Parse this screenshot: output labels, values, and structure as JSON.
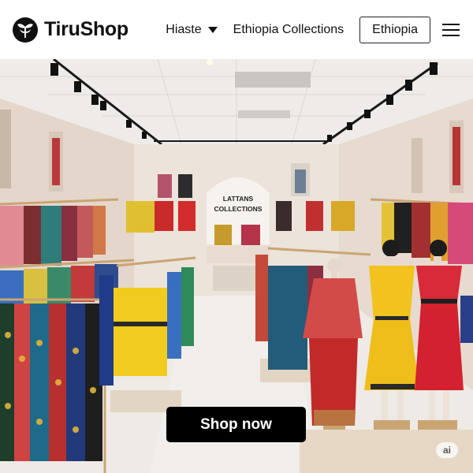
{
  "header": {
    "brand_name": "TiruShop",
    "logo_icon": "tirushop-logo-icon",
    "nav_items": [
      {
        "label": "Hiaste",
        "has_dropdown": true
      },
      {
        "label": "Ethiopia Collections",
        "has_dropdown": false
      }
    ],
    "country_button": "Ethiopia",
    "menu_icon": "hamburger-menu-icon"
  },
  "hero": {
    "image_description_icon": "store-interior-photo",
    "sign_line1": "LATTANS",
    "sign_line2": "COLLECTIONS",
    "cta_label": "Shop now",
    "ai_badge": "ai"
  },
  "colors": {
    "header_bg": "#ffffff",
    "cta_bg": "#000000",
    "cta_text": "#ffffff",
    "wall": "#e9e0d8",
    "floor": "#eeeae6",
    "rail": "#c9a574"
  }
}
